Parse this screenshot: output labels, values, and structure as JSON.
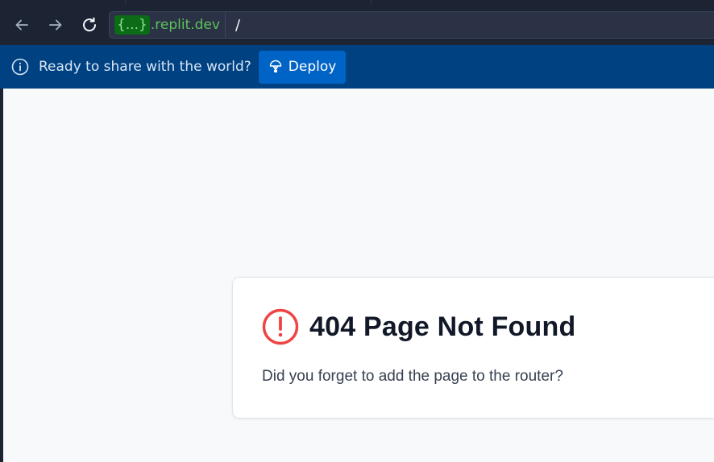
{
  "toolbar": {
    "back_icon": "arrow-left-icon",
    "forward_icon": "arrow-right-icon",
    "reload_icon": "reload-icon",
    "address": {
      "domain_highlight": "{...}",
      "domain_suffix": ".replit.dev",
      "path": "/"
    }
  },
  "banner": {
    "info_icon": "info-icon",
    "message": "Ready to share with the world?",
    "deploy_label": "Deploy",
    "deploy_icon": "deploy-icon",
    "background": "#004182",
    "button_color": "#0063c6"
  },
  "page": {
    "error_icon": "alert-circle-icon",
    "title": "404 Page Not Found",
    "message": "Did you forget to add the page to the router?",
    "error_color": "#ef4444"
  }
}
